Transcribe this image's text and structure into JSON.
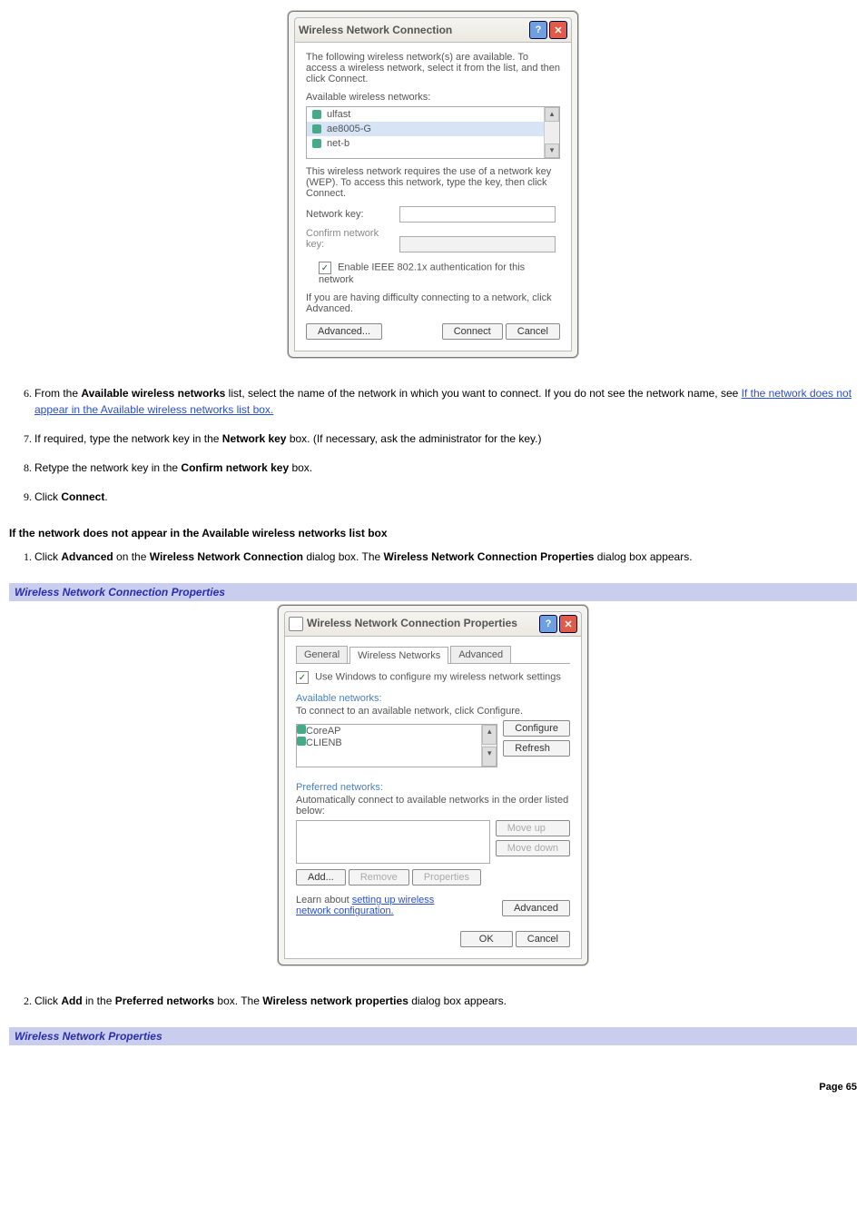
{
  "dialog1": {
    "title": "Wireless Network Connection",
    "intro": "The following wireless network(s) are available. To access a wireless network, select it from the list, and then click Connect.",
    "list_label": "Available wireless networks:",
    "networks": [
      "ulfast",
      "ae8005-G",
      "net-b"
    ],
    "wep_text": "This wireless network requires the use of a network key (WEP). To access this network, type the key, then click Connect.",
    "key_label": "Network key:",
    "confirm_label": "Confirm network key:",
    "ieee_check": "Enable IEEE 802.1x authentication for this network",
    "difficulty": "If you are having difficulty connecting to a network, click Advanced.",
    "btn_advanced": "Advanced...",
    "btn_connect": "Connect",
    "btn_cancel": "Cancel"
  },
  "steps_a": {
    "s6a": "From the ",
    "s6b": "Available wireless networks",
    "s6c": " list, select the name of the network in which you want to connect. If you do not see the network name, see ",
    "s6link": "If the network does not appear in the Available wireless networks list box.",
    "s7a": "If required, type the network key in the ",
    "s7b": "Network key",
    "s7c": " box. (If necessary, ask the administrator for the key.)",
    "s8a": "Retype the network key in the ",
    "s8b": "Confirm network key",
    "s8c": " box.",
    "s9a": "Click ",
    "s9b": "Connect",
    "s9c": "."
  },
  "heading1": "If the network does not appear in the Available wireless networks list box",
  "steps_b": {
    "s1a": "Click ",
    "s1b": "Advanced",
    "s1c": " on the ",
    "s1d": "Wireless Network Connection",
    "s1e": " dialog box. The ",
    "s1f": "Wireless Network Connection Properties",
    "s1g": " dialog box appears."
  },
  "banner1": "Wireless Network Connection Properties",
  "dialog2": {
    "title": "Wireless Network Connection Properties",
    "tab_general": "General",
    "tab_wireless": "Wireless Networks",
    "tab_advanced": "Advanced",
    "use_windows": "Use Windows to configure my wireless network settings",
    "avail_label": "Available networks:",
    "avail_text": "To connect to an available network, click Configure.",
    "avail_items": [
      "CoreAP",
      "CLIENB"
    ],
    "btn_configure": "Configure",
    "btn_refresh": "Refresh",
    "pref_label": "Preferred networks:",
    "pref_text": "Automatically connect to available networks in the order listed below:",
    "btn_moveup": "Move up",
    "btn_movedown": "Move down",
    "btn_add": "Add...",
    "btn_remove": "Remove",
    "btn_properties": "Properties",
    "learn_a": "Learn about ",
    "learn_link": "setting up wireless network configuration.",
    "btn_advanced2": "Advanced",
    "btn_ok": "OK",
    "btn_cancel": "Cancel"
  },
  "steps_c": {
    "s2a": "Click ",
    "s2b": "Add",
    "s2c": " in the ",
    "s2d": "Preferred networks",
    "s2e": " box. The ",
    "s2f": "Wireless network properties",
    "s2g": " dialog box appears."
  },
  "banner2": "Wireless Network Properties",
  "page_footer": "Page 65"
}
